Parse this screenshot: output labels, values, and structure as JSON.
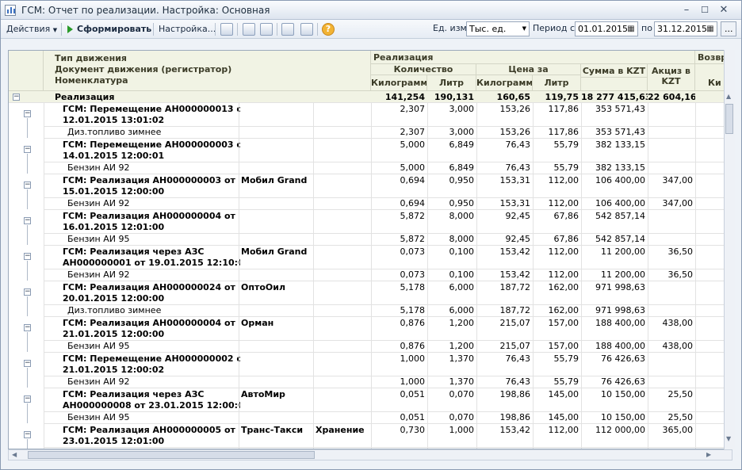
{
  "window": {
    "title": "ГСМ: Отчет по реализации. Настройка: Основная"
  },
  "toolbar": {
    "actions": "Действия",
    "generate": "Сформировать",
    "settings": "Настройка...",
    "unit_label": "Ед. изм",
    "unit_value": "Тыс. ед.",
    "period_label": "Период с:",
    "date_from": "01.01.2015",
    "to_label": "по",
    "date_to": "31.12.2015",
    "more": "..."
  },
  "columns": {
    "type": "Тип движения",
    "doc": "Документ движения (регистратор)",
    "nom": "Номенклатура",
    "realization": "Реализация",
    "qty": "Количество",
    "price": "Цена за",
    "sum": "Сумма в KZT",
    "excise": "Акциз в KZT",
    "return": "Возвр",
    "kg": "Килограмм",
    "l": "Литр",
    "pkg": "Килограмм",
    "pl": "Литр",
    "ki": "Ки"
  },
  "total": {
    "name": "Реализация",
    "kg": "141,254",
    "l": "190,131",
    "pkg": "160,65",
    "pl": "119,75",
    "sum": "18 277 415,63",
    "exc": "22 604,16"
  },
  "groups": [
    {
      "doc1": "ГСМ: Перемещение АН000000013 от",
      "doc2": "12.01.2015 13:01:02",
      "contr": "",
      "store": "",
      "kg": "2,307",
      "l": "3,000",
      "pkg": "153,26",
      "pl": "117,86",
      "sum": "353 571,43",
      "exc": "",
      "item": "Диз.топливо зимнее"
    },
    {
      "doc1": "ГСМ: Перемещение АН000000003 от",
      "doc2": "14.01.2015 12:00:01",
      "contr": "",
      "store": "",
      "kg": "5,000",
      "l": "6,849",
      "pkg": "76,43",
      "pl": "55,79",
      "sum": "382 133,15",
      "exc": "",
      "item": "Бензин АИ 92"
    },
    {
      "doc1": "ГСМ: Реализация АН000000003 от",
      "doc2": "15.01.2015 12:00:00",
      "contr": "Мобил Grand",
      "store": "",
      "kg": "0,694",
      "l": "0,950",
      "pkg": "153,31",
      "pl": "112,00",
      "sum": "106 400,00",
      "exc": "347,00",
      "item": "Бензин АИ 92"
    },
    {
      "doc1": "ГСМ: Реализация АН000000004 от",
      "doc2": "16.01.2015 12:01:00",
      "contr": "",
      "store": "",
      "kg": "5,872",
      "l": "8,000",
      "pkg": "92,45",
      "pl": "67,86",
      "sum": "542 857,14",
      "exc": "",
      "item": "Бензин АИ 95"
    },
    {
      "doc1": "ГСМ: Реализация через АЗС",
      "doc2": "АН000000001 от 19.01.2015 12:10:00",
      "contr": "Мобил Grand",
      "store": "",
      "kg": "0,073",
      "l": "0,100",
      "pkg": "153,42",
      "pl": "112,00",
      "sum": "11 200,00",
      "exc": "36,50",
      "item": "Бензин АИ 92"
    },
    {
      "doc1": "ГСМ: Реализация АН000000024 от",
      "doc2": "20.01.2015 12:00:00",
      "contr": "ОптоОил",
      "store": "",
      "kg": "5,178",
      "l": "6,000",
      "pkg": "187,72",
      "pl": "162,00",
      "sum": "971 998,63",
      "exc": "",
      "item": "Диз.топливо зимнее"
    },
    {
      "doc1": "ГСМ: Реализация АН000000004 от",
      "doc2": "21.01.2015 12:00:00",
      "contr": "Орман",
      "store": "",
      "kg": "0,876",
      "l": "1,200",
      "pkg": "215,07",
      "pl": "157,00",
      "sum": "188 400,00",
      "exc": "438,00",
      "item": "Бензин АИ 95"
    },
    {
      "doc1": "ГСМ: Перемещение АН000000002 от",
      "doc2": "21.01.2015 12:00:02",
      "contr": "",
      "store": "",
      "kg": "1,000",
      "l": "1,370",
      "pkg": "76,43",
      "pl": "55,79",
      "sum": "76 426,63",
      "exc": "",
      "item": "Бензин АИ 92"
    },
    {
      "doc1": "ГСМ: Реализация через АЗС",
      "doc2": "АН000000008 от 23.01.2015 12:00:00",
      "contr": "АвтоМир",
      "store": "",
      "kg": "0,051",
      "l": "0,070",
      "pkg": "198,86",
      "pl": "145,00",
      "sum": "10 150,00",
      "exc": "25,50",
      "item": "Бензин АИ 95"
    },
    {
      "doc1": "ГСМ: Реализация АН000000005 от",
      "doc2": "23.01.2015 12:01:00",
      "contr": "Транс-Такси",
      "store": "Хранение",
      "kg": "0,730",
      "l": "1,000",
      "pkg": "153,42",
      "pl": "112,00",
      "sum": "112 000,00",
      "exc": "365,00",
      "item": "Бензин АИ 92"
    }
  ]
}
